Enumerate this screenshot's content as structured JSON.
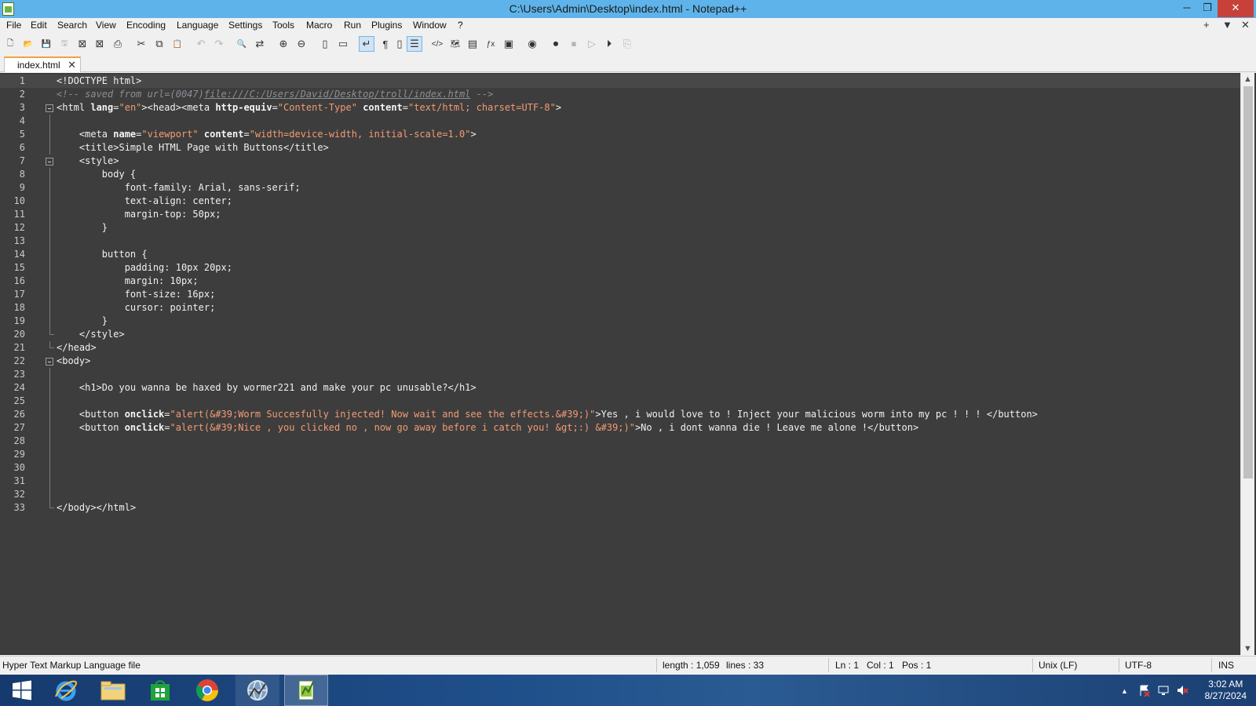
{
  "window": {
    "title": "C:\\Users\\Admin\\Desktop\\index.html - Notepad++",
    "minimize_glyph": "─",
    "restore_glyph": "❐",
    "close_glyph": "✕"
  },
  "menu": {
    "items": [
      "File",
      "Edit",
      "Search",
      "View",
      "Encoding",
      "Language",
      "Settings",
      "Tools",
      "Macro",
      "Run",
      "Plugins",
      "Window",
      "?"
    ],
    "right_controls": [
      "+",
      "▼",
      "✕"
    ]
  },
  "toolbar": {
    "buttons": [
      {
        "icon": "new-file-icon",
        "glyph": "🗋"
      },
      {
        "icon": "open-file-icon",
        "glyph": "📂"
      },
      {
        "icon": "save-icon",
        "glyph": "💾"
      },
      {
        "icon": "save-all-icon",
        "glyph": "🖫"
      },
      {
        "icon": "close-file-icon",
        "glyph": "⊠"
      },
      {
        "icon": "close-all-icon",
        "glyph": "⊠"
      },
      {
        "icon": "print-icon",
        "glyph": "⎙"
      },
      {
        "icon": "cut-icon",
        "glyph": "✂"
      },
      {
        "icon": "copy-icon",
        "glyph": "⧉"
      },
      {
        "icon": "paste-icon",
        "glyph": "📋"
      },
      {
        "icon": "undo-icon",
        "glyph": "↶"
      },
      {
        "icon": "redo-icon",
        "glyph": "↷"
      },
      {
        "icon": "find-icon",
        "glyph": "🔍"
      },
      {
        "icon": "replace-icon",
        "glyph": "⇄"
      },
      {
        "icon": "zoom-in-icon",
        "glyph": "⊕"
      },
      {
        "icon": "zoom-out-icon",
        "glyph": "⊖"
      },
      {
        "icon": "sync-vertical-icon",
        "glyph": "▯"
      },
      {
        "icon": "sync-horizontal-icon",
        "glyph": "▭"
      },
      {
        "icon": "word-wrap-icon",
        "glyph": "↵"
      },
      {
        "icon": "show-all-chars-icon",
        "glyph": "¶"
      },
      {
        "icon": "indent-guide-icon",
        "glyph": "▯"
      },
      {
        "icon": "outline-icon",
        "glyph": "☰"
      },
      {
        "icon": "tag-match-icon",
        "glyph": "</>"
      },
      {
        "icon": "document-map-icon",
        "glyph": "🗺"
      },
      {
        "icon": "document-list-icon",
        "glyph": "▤"
      },
      {
        "icon": "function-list-icon",
        "glyph": "ƒx"
      },
      {
        "icon": "folder-workspace-icon",
        "glyph": "▣"
      },
      {
        "icon": "monitoring-icon",
        "glyph": "◉"
      },
      {
        "icon": "record-macro-icon",
        "glyph": "⏺"
      },
      {
        "icon": "stop-record-icon",
        "glyph": "⏹"
      },
      {
        "icon": "play-macro-icon",
        "glyph": "▷"
      },
      {
        "icon": "run-macro-multiple-icon",
        "glyph": "⏵"
      },
      {
        "icon": "save-macro-icon",
        "glyph": "⎘"
      }
    ]
  },
  "tab": {
    "label": "index.html",
    "close_glyph": "✕"
  },
  "editor": {
    "lines": [
      {
        "n": "1",
        "segs": [
          [
            "tag",
            "<!DOCTYPE html>"
          ]
        ]
      },
      {
        "n": "2",
        "segs": [
          [
            "cmt",
            "<!-- saved from url=(0047)"
          ],
          [
            "cmt-link",
            "file:///C:/Users/David/Desktop/troll/index.html"
          ],
          [
            "cmt",
            " -->"
          ]
        ]
      },
      {
        "n": "3",
        "fold": "box",
        "segs": [
          [
            "tag",
            "<html "
          ],
          [
            "attr",
            "lang"
          ],
          [
            "tag",
            "="
          ],
          [
            "str",
            "\"en\""
          ],
          [
            "tag",
            "><head><meta "
          ],
          [
            "attr",
            "http-equiv"
          ],
          [
            "tag",
            "="
          ],
          [
            "str",
            "\"Content-Type\""
          ],
          [
            "tag",
            " "
          ],
          [
            "attr",
            "content"
          ],
          [
            "tag",
            "="
          ],
          [
            "str",
            "\"text/html; charset=UTF-8\""
          ],
          [
            "tag",
            ">"
          ]
        ]
      },
      {
        "n": "4",
        "fold": "line",
        "segs": []
      },
      {
        "n": "5",
        "fold": "line",
        "segs": [
          [
            "tag",
            "    <meta "
          ],
          [
            "attr",
            "name"
          ],
          [
            "tag",
            "="
          ],
          [
            "str",
            "\"viewport\""
          ],
          [
            "tag",
            " "
          ],
          [
            "attr",
            "content"
          ],
          [
            "tag",
            "="
          ],
          [
            "str",
            "\"width=device-width, initial-scale=1.0\""
          ],
          [
            "tag",
            ">"
          ]
        ]
      },
      {
        "n": "6",
        "fold": "line",
        "segs": [
          [
            "tag",
            "    <title>Simple HTML Page with Buttons</title>"
          ]
        ]
      },
      {
        "n": "7",
        "fold": "box",
        "segs": [
          [
            "tag",
            "    <style>"
          ]
        ]
      },
      {
        "n": "8",
        "fold": "line",
        "segs": [
          [
            "tag",
            "        body {"
          ]
        ]
      },
      {
        "n": "9",
        "fold": "line",
        "segs": [
          [
            "tag",
            "            font-family: Arial, sans-serif;"
          ]
        ]
      },
      {
        "n": "10",
        "fold": "line",
        "segs": [
          [
            "tag",
            "            text-align: center;"
          ]
        ]
      },
      {
        "n": "11",
        "fold": "line",
        "segs": [
          [
            "tag",
            "            margin-top: 50px;"
          ]
        ]
      },
      {
        "n": "12",
        "fold": "line",
        "segs": [
          [
            "tag",
            "        }"
          ]
        ]
      },
      {
        "n": "13",
        "fold": "line",
        "segs": []
      },
      {
        "n": "14",
        "fold": "line",
        "segs": [
          [
            "tag",
            "        button {"
          ]
        ]
      },
      {
        "n": "15",
        "fold": "line",
        "segs": [
          [
            "tag",
            "            padding: 10px 20px;"
          ]
        ]
      },
      {
        "n": "16",
        "fold": "line",
        "segs": [
          [
            "tag",
            "            margin: 10px;"
          ]
        ]
      },
      {
        "n": "17",
        "fold": "line",
        "segs": [
          [
            "tag",
            "            font-size: 16px;"
          ]
        ]
      },
      {
        "n": "18",
        "fold": "line",
        "segs": [
          [
            "tag",
            "            cursor: pointer;"
          ]
        ]
      },
      {
        "n": "19",
        "fold": "line",
        "segs": [
          [
            "tag",
            "        }"
          ]
        ]
      },
      {
        "n": "20",
        "fold": "end",
        "segs": [
          [
            "tag",
            "    </style>"
          ]
        ]
      },
      {
        "n": "21",
        "fold": "end",
        "segs": [
          [
            "tag",
            "</head>"
          ]
        ]
      },
      {
        "n": "22",
        "fold": "box",
        "segs": [
          [
            "tag",
            "<body>"
          ]
        ]
      },
      {
        "n": "23",
        "fold": "line",
        "segs": []
      },
      {
        "n": "24",
        "fold": "line",
        "segs": [
          [
            "tag",
            "    <h1>Do you wanna be haxed by wormer221 and make your pc unusable?</h1>"
          ]
        ]
      },
      {
        "n": "25",
        "fold": "line",
        "segs": []
      },
      {
        "n": "26",
        "fold": "line",
        "segs": [
          [
            "tag",
            "    <button "
          ],
          [
            "attr",
            "onclick"
          ],
          [
            "tag",
            "="
          ],
          [
            "str",
            "\"alert(&#39;Worm Succesfully injected! Now wait and see the effects.&#39;)\""
          ],
          [
            "tag",
            ">Yes , i would love to ! Inject your malicious worm into my pc ! ! ! </button>"
          ]
        ]
      },
      {
        "n": "27",
        "fold": "line",
        "segs": [
          [
            "tag",
            "    <button "
          ],
          [
            "attr",
            "onclick"
          ],
          [
            "tag",
            "="
          ],
          [
            "str",
            "\"alert(&#39;Nice , you clicked no , now go away before i catch you! &gt;:) &#39;)\""
          ],
          [
            "tag",
            ">No , i dont wanna die ! Leave me alone !</button>"
          ]
        ]
      },
      {
        "n": "28",
        "fold": "line",
        "segs": []
      },
      {
        "n": "29",
        "fold": "line",
        "segs": []
      },
      {
        "n": "30",
        "fold": "line",
        "segs": []
      },
      {
        "n": "31",
        "fold": "line",
        "segs": []
      },
      {
        "n": "32",
        "fold": "line",
        "segs": []
      },
      {
        "n": "33",
        "fold": "end",
        "segs": [
          [
            "tag",
            "</body></html>"
          ]
        ]
      }
    ],
    "current_line": 1
  },
  "status": {
    "language": "Hyper Text Markup Language file",
    "length": "length : 1,059",
    "lines": "lines : 33",
    "ln": "Ln : 1",
    "col": "Col : 1",
    "pos": "Pos : 1",
    "eol": "Unix (LF)",
    "encoding": "UTF-8",
    "mode": "INS"
  },
  "taskbar": {
    "apps": [
      {
        "name": "start-button",
        "icon": "windows-logo-icon"
      },
      {
        "name": "taskbar-internet-explorer",
        "icon": "internet-explorer-icon"
      },
      {
        "name": "taskbar-file-explorer",
        "icon": "folder-icon"
      },
      {
        "name": "taskbar-store",
        "icon": "store-icon"
      },
      {
        "name": "taskbar-chrome",
        "icon": "chrome-icon"
      },
      {
        "name": "taskbar-network-app",
        "icon": "globe-icon"
      },
      {
        "name": "taskbar-notepadpp",
        "icon": "notepadpp-icon"
      }
    ],
    "clock_time": "3:02 AM",
    "clock_date": "8/27/2024",
    "tray_chevron": "▲"
  }
}
